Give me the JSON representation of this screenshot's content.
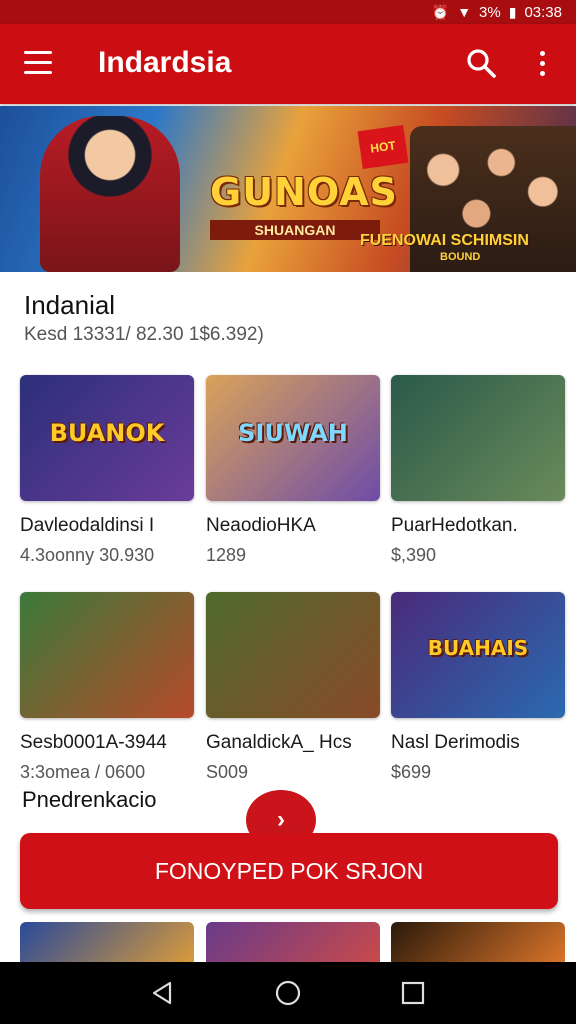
{
  "status_bar": {
    "battery": "3%",
    "time": "03:38"
  },
  "app_bar": {
    "title": "Indardsia"
  },
  "banner": {
    "logo_title": "GUNOAS",
    "logo_subtitle": "SHUANGAN",
    "badge": "HOT",
    "tagline": "FUENOWAI SCHIMSIN",
    "tagline_small": "BOUND"
  },
  "section": {
    "title": "Indanial",
    "subtitle": "Kesd 13331/ 82.30 1$6.392)"
  },
  "cards": [
    {
      "name": "Davleodaldinsi I",
      "price": "4.3oonny 30.930",
      "thumb_text": "BUANOK",
      "colors": [
        "#2c2f7a",
        "#6a3c9a"
      ]
    },
    {
      "name": "NeaodioHKA",
      "price": "1289",
      "thumb_text": "SIUWAH",
      "colors": [
        "#d9a35a",
        "#6e4ca8"
      ]
    },
    {
      "name": "PuarHedotkan.",
      "price": "$,390",
      "thumb_text": "",
      "colors": [
        "#2a5a4a",
        "#6a8a5a"
      ]
    },
    {
      "name": "Sesb0001A-3944",
      "price": "3:3omea / 0600",
      "thumb_text": "",
      "colors": [
        "#3a7a3a",
        "#b74a2a"
      ]
    },
    {
      "name": "GanaldickA_ Hcs",
      "price": "S009",
      "thumb_text": "",
      "colors": [
        "#4e6a2a",
        "#8a4a2a"
      ]
    },
    {
      "name": "Nasl Derimodis",
      "price": "$699",
      "thumb_text": "BUAHAIS",
      "colors": [
        "#4a2a7a",
        "#2a6ab0"
      ]
    }
  ],
  "section2": {
    "title": "Pnedrenkacio"
  },
  "cta": {
    "label": "FONOYPED POK SRJON",
    "fab_icon": "chevron-right"
  },
  "peek_colors": [
    "#2a4a9a",
    "#6a3a8a",
    "#2a1a0a"
  ],
  "nav": {
    "back": "back-icon",
    "home": "home-icon",
    "recents": "recents-icon"
  }
}
